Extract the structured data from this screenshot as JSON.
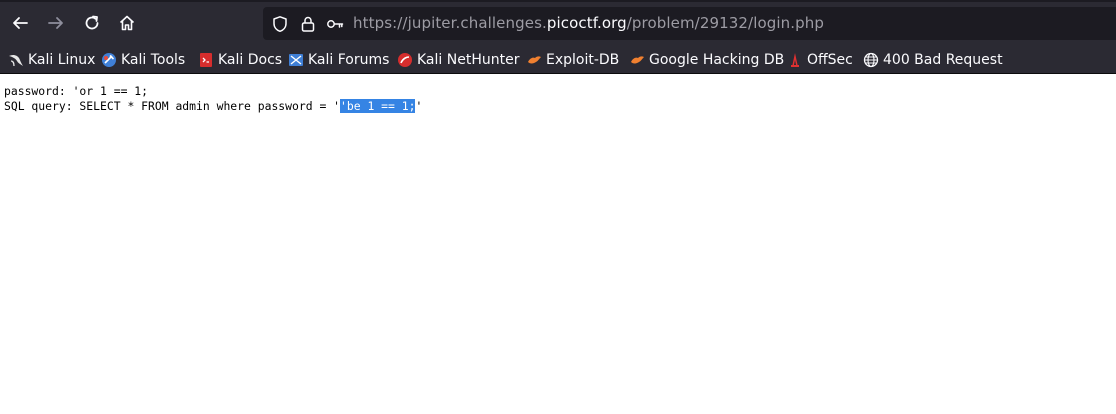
{
  "browser": {
    "url_prefix": "https://jupiter.challenges.",
    "url_host": "picoctf.org",
    "url_path": "/problem/29132/login.php"
  },
  "bookmarks": [
    {
      "label": "Kali Linux",
      "icon": "kali-dragon-icon"
    },
    {
      "label": "Kali Tools",
      "icon": "kali-tools-icon"
    },
    {
      "label": "Kali Docs",
      "icon": "kali-docs-icon"
    },
    {
      "label": "Kali Forums",
      "icon": "kali-forums-icon"
    },
    {
      "label": "Kali NetHunter",
      "icon": "kali-nethunter-icon"
    },
    {
      "label": "Exploit-DB",
      "icon": "exploit-db-icon"
    },
    {
      "label": "Google Hacking DB",
      "icon": "ghdb-icon"
    },
    {
      "label": "OffSec",
      "icon": "offsec-icon"
    },
    {
      "label": "400 Bad Request",
      "icon": "globe-icon"
    }
  ],
  "page": {
    "password_line": "password: 'or 1 == 1;",
    "query_prefix": "SQL query: SELECT * FROM admin where password = '",
    "query_selected": "'be 1 == 1;",
    "query_suffix": "'"
  },
  "colors": {
    "toolbar_bg": "#2b2a33",
    "urlbar_bg": "#1c1b22",
    "selection": "#3584e4"
  }
}
